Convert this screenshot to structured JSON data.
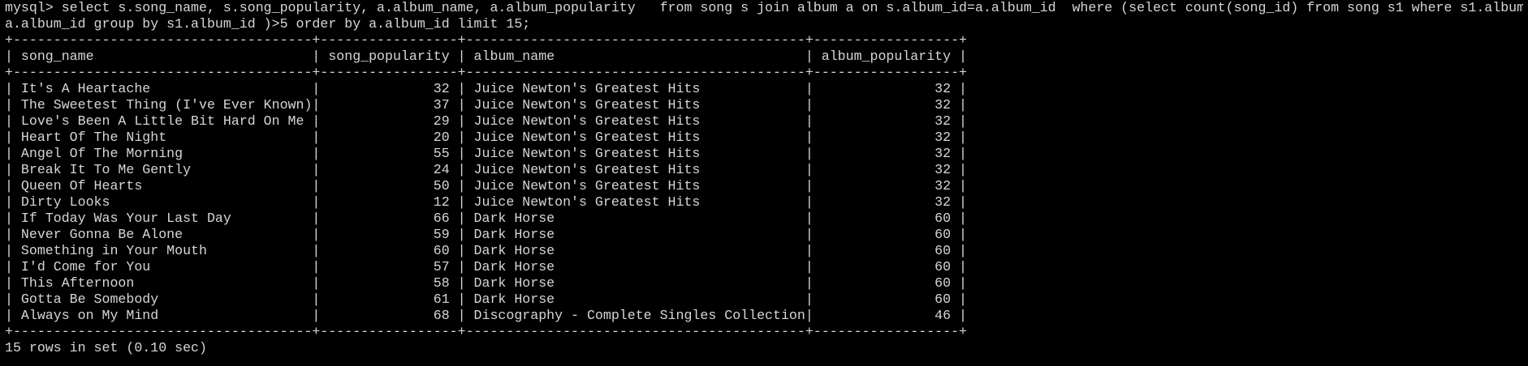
{
  "terminal": {
    "prompt_line_1": "mysql> select s.song_name, s.song_popularity, a.album_name, a.album_popularity   from song s join album a on s.album_id=a.album_id  where (select count(song_id) from song s1 where s1.album_id=",
    "prompt_line_2": "a.album_id group by s1.album_id )>5 order by a.album_id limit 15;",
    "border_line": "+-------------------------------------+-----------------+------------------------------------------+------------------+",
    "header_line": "| song_name                           | song_popularity | album_name                               | album_popularity |",
    "rows": [
      "| It's A Heartache                    |              32 | Juice Newton's Greatest Hits             |               32 |",
      "| The Sweetest Thing (I've Ever Known)|              37 | Juice Newton's Greatest Hits             |               32 |",
      "| Love's Been A Little Bit Hard On Me |              29 | Juice Newton's Greatest Hits             |               32 |",
      "| Heart Of The Night                  |              20 | Juice Newton's Greatest Hits             |               32 |",
      "| Angel Of The Morning                |              55 | Juice Newton's Greatest Hits             |               32 |",
      "| Break It To Me Gently               |              24 | Juice Newton's Greatest Hits             |               32 |",
      "| Queen Of Hearts                     |              50 | Juice Newton's Greatest Hits             |               32 |",
      "| Dirty Looks                         |              12 | Juice Newton's Greatest Hits             |               32 |",
      "| If Today Was Your Last Day          |              66 | Dark Horse                               |               60 |",
      "| Never Gonna Be Alone                |              59 | Dark Horse                               |               60 |",
      "| Something in Your Mouth             |              60 | Dark Horse                               |               60 |",
      "| I'd Come for You                    |              57 | Dark Horse                               |               60 |",
      "| This Afternoon                      |              58 | Dark Horse                               |               60 |",
      "| Gotta Be Somebody                   |              61 | Dark Horse                               |               60 |",
      "| Always on My Mind                   |              68 | Discography - Complete Singles Collection|               46 |"
    ],
    "result_line": "15 rows in set (0.10 sec)"
  }
}
